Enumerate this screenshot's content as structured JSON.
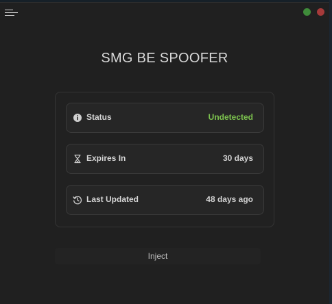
{
  "header": {
    "title": "SMG BE SPOOFER",
    "menu_icon": "hamburger-icon",
    "window_controls": {
      "maximize_color": "#3f8c3a",
      "close_color": "#a63a3a"
    }
  },
  "info": {
    "rows": [
      {
        "icon": "info-icon",
        "label": "Status",
        "value": "Undetected",
        "value_color": "#7cc24e"
      },
      {
        "icon": "hourglass-icon",
        "label": "Expires In",
        "value": "30 days"
      },
      {
        "icon": "history-icon",
        "label": "Last Updated",
        "value": "48 days ago"
      }
    ]
  },
  "actions": {
    "inject_label": "Inject"
  }
}
